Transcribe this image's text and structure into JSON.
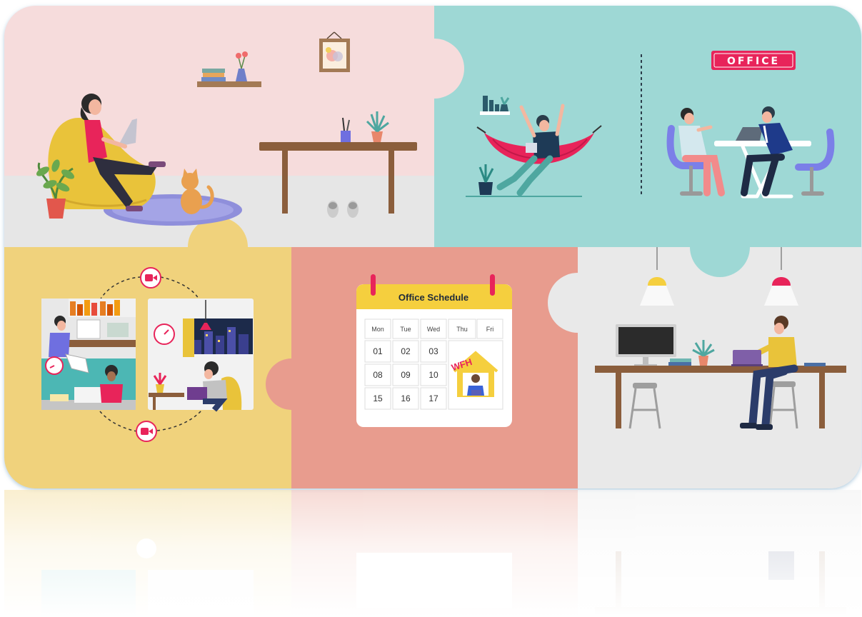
{
  "illustration": {
    "office_sign": "OFFICE",
    "calendar": {
      "title": "Office Schedule",
      "days": [
        "Mon",
        "Tue",
        "Wed",
        "Thu",
        "Fri"
      ],
      "rows": [
        [
          "01",
          "02",
          "03"
        ],
        [
          "08",
          "09",
          "10"
        ],
        [
          "15",
          "16",
          "17"
        ]
      ],
      "wfh_label": "WFH"
    }
  },
  "colors": {
    "panel_pink": "#f6dcdc",
    "panel_teal": "#9ed8d5",
    "panel_yellow": "#f0d27c",
    "panel_salmon": "#e89c8e",
    "panel_gray": "#e9e9e9",
    "accent_red": "#e8245a",
    "calendar_header": "#f5cf3e"
  }
}
